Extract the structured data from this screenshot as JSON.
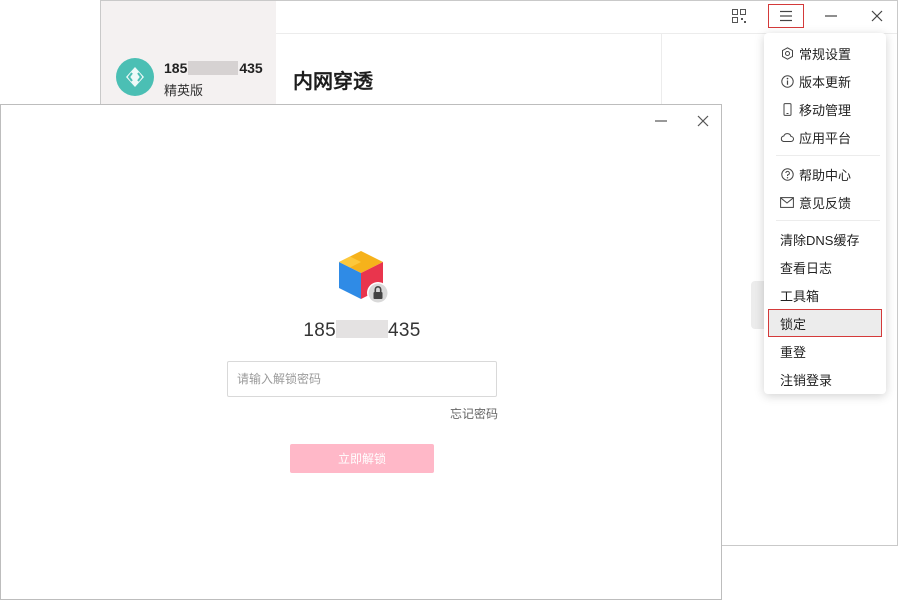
{
  "back_window": {
    "user": {
      "phone_prefix": "185",
      "phone_suffix": "435",
      "edition": "精英版"
    },
    "page_title": "内网穿透"
  },
  "dropdown_menu": {
    "group1": [
      {
        "label": "常规设置",
        "icon": "gear-icon"
      },
      {
        "label": "版本更新",
        "icon": "info-icon"
      },
      {
        "label": "移动管理",
        "icon": "phone-icon"
      },
      {
        "label": "应用平台",
        "icon": "cloud-icon"
      }
    ],
    "group2": [
      {
        "label": "帮助中心",
        "icon": "help-icon"
      },
      {
        "label": "意见反馈",
        "icon": "mail-icon"
      }
    ],
    "group3": [
      {
        "label": "清除DNS缓存"
      },
      {
        "label": "查看日志"
      },
      {
        "label": "工具箱"
      },
      {
        "label": "锁定",
        "selected": true
      },
      {
        "label": "重登"
      },
      {
        "label": "注销登录"
      }
    ]
  },
  "lock_dialog": {
    "phone_prefix": "185",
    "phone_suffix": "435",
    "password_placeholder": "请输入解锁密码",
    "forgot_label": "忘记密码",
    "unlock_label": "立即解锁"
  },
  "colors": {
    "accent_red": "#d43a3a",
    "unlock_button": "#ffb8c8",
    "avatar": "#4bbfb4"
  }
}
